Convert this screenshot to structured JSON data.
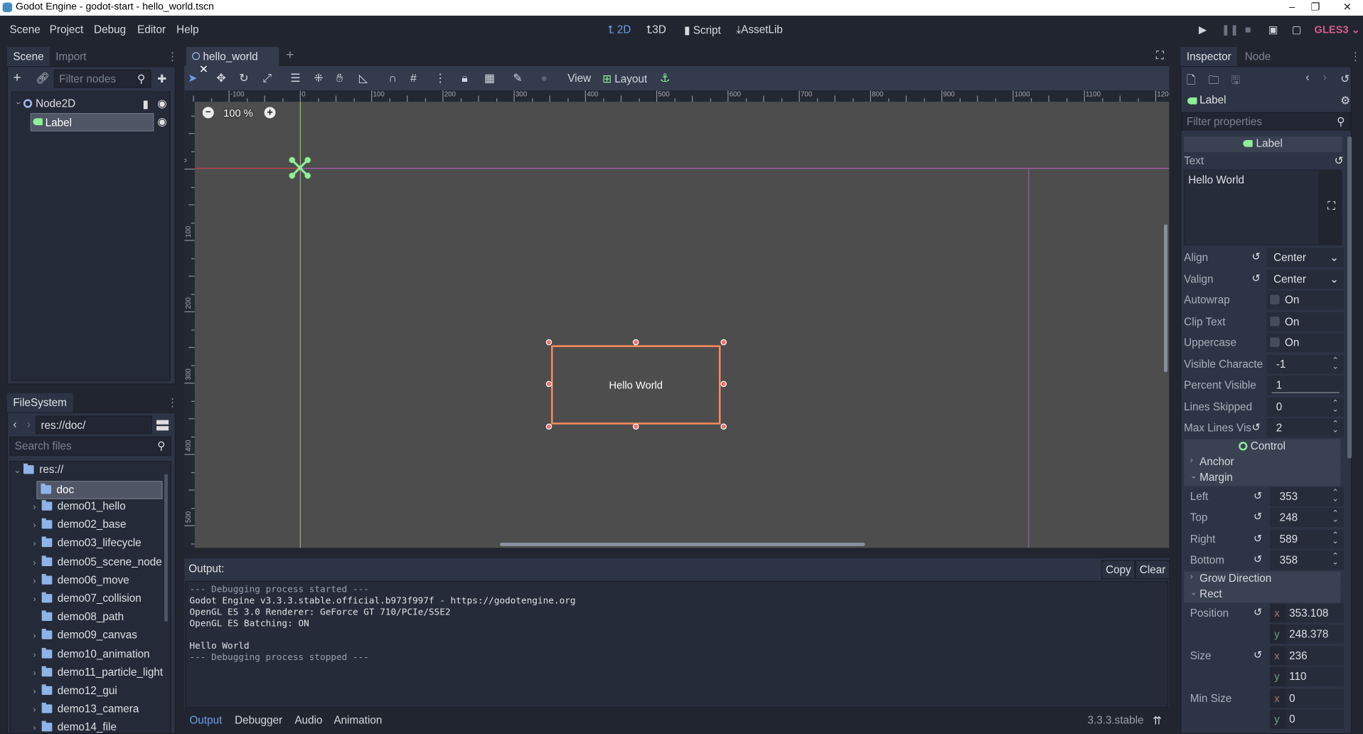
{
  "window": {
    "title": "Godot Engine - godot-start - hello_world.tscn",
    "controls": [
      "–",
      "❐",
      "✕"
    ]
  },
  "menu": [
    "Scene",
    "Project",
    "Debug",
    "Editor",
    "Help"
  ],
  "workspaces": [
    {
      "label": "2D",
      "icon": "2d-icon",
      "active": true
    },
    {
      "label": "3D",
      "icon": "3d-icon"
    },
    {
      "label": "Script",
      "icon": "script-icon"
    },
    {
      "label": "AssetLib",
      "icon": "assetlib-icon"
    }
  ],
  "renderer": "GLES3",
  "colors": {
    "accent": "#6d9de8",
    "renderer": "#d55d8a",
    "selection": "#ff8c5a",
    "node_green": "#8eef97",
    "folder": "#8fb3e8"
  },
  "scene_dock": {
    "tabs": [
      "Scene",
      "Import"
    ],
    "filter_placeholder": "Filter nodes",
    "nodes": [
      {
        "name": "Node2D",
        "type": "Node2D"
      },
      {
        "name": "Label",
        "type": "Label",
        "selected": true
      }
    ]
  },
  "filesystem": {
    "tab": "FileSystem",
    "path": "res://doc/",
    "search_placeholder": "Search files",
    "root": "res://",
    "current": "doc",
    "items": [
      "demo01_hello",
      "demo02_base",
      "demo03_lifecycle",
      "demo05_scene_node",
      "demo06_move",
      "demo07_collision",
      "demo08_path",
      "demo09_canvas",
      "demo10_animation",
      "demo11_particle_light",
      "demo12_gui",
      "demo13_camera",
      "demo14_file"
    ]
  },
  "editor": {
    "scene_tab": "hello_world",
    "toolbar": {
      "view": "View",
      "layout": "Layout"
    },
    "zoom": "100 %",
    "ruler_h": [
      "-100",
      "0",
      "100",
      "200",
      "300",
      "400",
      "500",
      "600",
      "700",
      "800",
      "900",
      "1000",
      "1100",
      "1200"
    ],
    "ruler_v": [
      "0",
      "100",
      "200",
      "300",
      "400",
      "500"
    ],
    "label_text": "Hello World"
  },
  "output": {
    "title": "Output:",
    "copy": "Copy",
    "clear": "Clear",
    "lines": [
      "--- Debugging process started ---",
      "Godot Engine v3.3.3.stable.official.b973f997f - https://godotengine.org",
      "OpenGL ES 3.0 Renderer: GeForce GT 710/PCIe/SSE2",
      "OpenGL ES Batching: ON",
      "",
      "Hello World",
      "--- Debugging process stopped ---"
    ],
    "bottom_tabs": [
      "Output",
      "Debugger",
      "Audio",
      "Animation"
    ],
    "version": "3.3.3.stable"
  },
  "inspector": {
    "tabs": [
      "Inspector",
      "Node"
    ],
    "object": "Label",
    "filter_placeholder": "Filter properties",
    "class_header": "Label",
    "text_label": "Text",
    "text_value": "Hello World",
    "properties": [
      {
        "kind": "enum",
        "name": "Align",
        "value": "Center",
        "revert": true
      },
      {
        "kind": "enum",
        "name": "Valign",
        "value": "Center",
        "revert": true
      },
      {
        "kind": "check",
        "name": "Autowrap",
        "value": "On",
        "checked": false
      },
      {
        "kind": "check",
        "name": "Clip Text",
        "value": "On",
        "checked": false
      },
      {
        "kind": "check",
        "name": "Uppercase",
        "value": "On",
        "checked": false
      },
      {
        "kind": "spin",
        "name": "Visible Characte",
        "value": "-1"
      },
      {
        "kind": "slider",
        "name": "Percent Visible",
        "value": "1",
        "fraction": 1
      },
      {
        "kind": "spin",
        "name": "Lines Skipped",
        "value": "0"
      },
      {
        "kind": "spin",
        "name": "Max Lines Visi",
        "value": "2",
        "revert": true
      },
      {
        "kind": "header",
        "name": "Control"
      },
      {
        "kind": "section",
        "name": "Anchor",
        "open": false
      },
      {
        "kind": "section",
        "name": "Margin",
        "open": true
      },
      {
        "kind": "spin",
        "name": "Left",
        "value": "353",
        "revert": true,
        "indent": true
      },
      {
        "kind": "spin",
        "name": "Top",
        "value": "248",
        "revert": true,
        "indent": true
      },
      {
        "kind": "spin",
        "name": "Right",
        "value": "589",
        "revert": true,
        "indent": true
      },
      {
        "kind": "spin",
        "name": "Bottom",
        "value": "358",
        "revert": true,
        "indent": true
      },
      {
        "kind": "section",
        "name": "Grow Direction",
        "open": false
      },
      {
        "kind": "section",
        "name": "Rect",
        "open": true
      },
      {
        "kind": "vec",
        "name": "Position",
        "axis": "x",
        "value": "353.108",
        "revert": true,
        "indent": true
      },
      {
        "kind": "vec",
        "name": "",
        "axis": "y",
        "value": "248.378",
        "indent": true
      },
      {
        "kind": "vec",
        "name": "Size",
        "axis": "x",
        "value": "236",
        "revert": true,
        "indent": true
      },
      {
        "kind": "vec",
        "name": "",
        "axis": "y",
        "value": "110",
        "indent": true
      },
      {
        "kind": "vec",
        "name": "Min Size",
        "axis": "x",
        "value": "0",
        "indent": true
      },
      {
        "kind": "vec",
        "name": "",
        "axis": "y",
        "value": "0",
        "indent": true
      }
    ]
  }
}
